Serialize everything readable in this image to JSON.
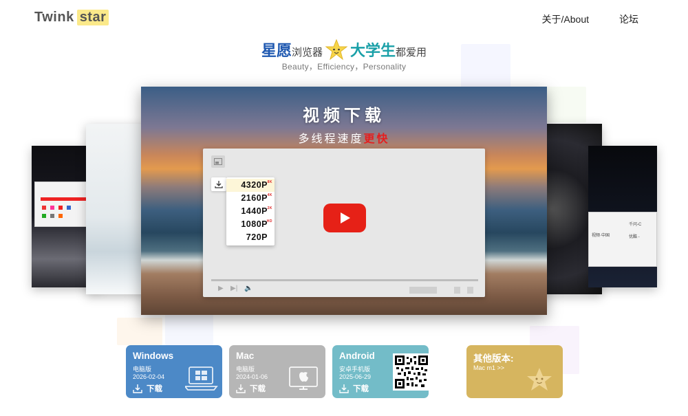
{
  "brand": {
    "part1": "Twink",
    "part2": "star",
    "accent": "#fbe98a"
  },
  "nav": {
    "about": "关于/About",
    "forum": "论坛"
  },
  "hero": {
    "w1": "星愿",
    "w2": "浏览器",
    "w3": "大学生",
    "w4": "都爱用",
    "tagline": "Beauty，Efficiency，Personality",
    "star_icon": "star-mascot-icon"
  },
  "slide": {
    "title": "视频下载",
    "subtitle_main": "多线程速度",
    "subtitle_highlight": "更快",
    "resolutions": [
      {
        "label": "4320P",
        "badge": "8K"
      },
      {
        "label": "2160P",
        "badge": "4K"
      },
      {
        "label": "1440P",
        "badge": "2K"
      },
      {
        "label": "1080P",
        "badge": "HD"
      },
      {
        "label": "720P",
        "badge": ""
      }
    ],
    "side_right_tabs": {
      "tab1": "千问-C",
      "tab2": "视频·中国",
      "tab3": "优酷 -"
    }
  },
  "downloads": [
    {
      "name": "Windows",
      "sub": "电脑版",
      "date": "2026-02-04",
      "action": "下载",
      "color": "#4c89c7",
      "device_icon": "laptop-windows-icon"
    },
    {
      "name": "Mac",
      "sub": "电脑版",
      "date": "2024-01-06",
      "action": "下载",
      "color": "#b6b6b6",
      "device_icon": "monitor-apple-icon"
    },
    {
      "name": "Android",
      "sub": "安卓手机版",
      "date": "2025-06-29",
      "action": "下载",
      "color": "#73bcc8",
      "device_icon": "phone-android-icon"
    },
    {
      "name": "其他版本:",
      "sub": "Mac m1 >>",
      "color": "#d6b55f",
      "device_icon": "star-mascot-icon"
    }
  ]
}
